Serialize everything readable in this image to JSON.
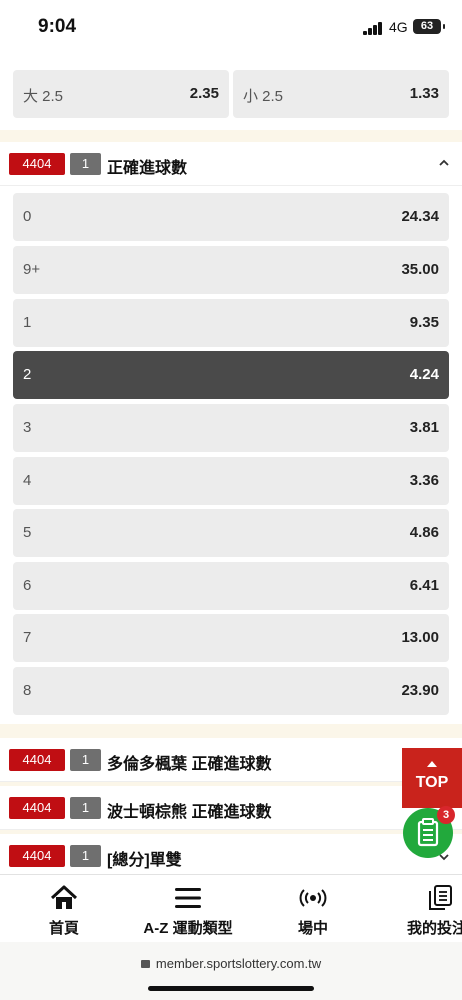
{
  "status": {
    "time": "9:04",
    "network": "4G",
    "battery": "63"
  },
  "over_under": [
    {
      "label": "大 2.5",
      "odds": "2.35"
    },
    {
      "label": "小 2.5",
      "odds": "1.33"
    }
  ],
  "market": {
    "code": "4404",
    "num": "1",
    "title": "正確進球數",
    "options": [
      {
        "label": "0",
        "odds": "24.34",
        "selected": false
      },
      {
        "label": "9+",
        "odds": "35.00",
        "selected": false
      },
      {
        "label": "1",
        "odds": "9.35",
        "selected": false
      },
      {
        "label": "2",
        "odds": "4.24",
        "selected": true
      },
      {
        "label": "3",
        "odds": "3.81",
        "selected": false
      },
      {
        "label": "4",
        "odds": "3.36",
        "selected": false
      },
      {
        "label": "5",
        "odds": "4.86",
        "selected": false
      },
      {
        "label": "6",
        "odds": "6.41",
        "selected": false
      },
      {
        "label": "7",
        "odds": "13.00",
        "selected": false
      },
      {
        "label": "8",
        "odds": "23.90",
        "selected": false
      }
    ]
  },
  "collapsed_markets": [
    {
      "code": "4404",
      "num": "1",
      "title": "多倫多楓葉 正確進球數"
    },
    {
      "code": "4404",
      "num": "1",
      "title": "波士頓棕熊 正確進球數"
    },
    {
      "code": "4404",
      "num": "1",
      "title": "[總分]單雙"
    }
  ],
  "floating": {
    "top_label": "TOP",
    "slip_count": "3"
  },
  "bottom_nav": [
    {
      "label": "首頁",
      "icon": "home-icon"
    },
    {
      "label": "A-Z 運動類型",
      "icon": "menu-icon"
    },
    {
      "label": "場中",
      "icon": "live-broadcast-icon"
    },
    {
      "label": "我的投注",
      "icon": "my-bets-icon"
    }
  ],
  "browser": {
    "url": "member.sportslottery.com.tw"
  },
  "colors": {
    "brand_red": "#c00e13",
    "selected_bg": "#4a4a4a",
    "cell_bg": "#ececec",
    "slip_green": "#22a93c"
  }
}
